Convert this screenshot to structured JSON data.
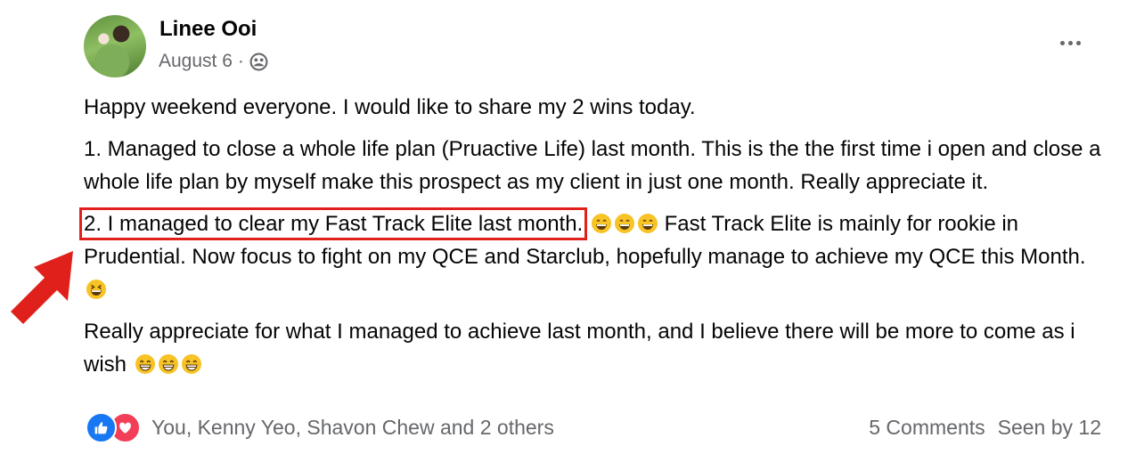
{
  "post": {
    "author": "Linee Ooi",
    "date": "August 6",
    "separator": "·",
    "privacy_icon": "group-icon",
    "paragraphs": [
      "Happy weekend everyone. I would like to share my 2 wins today.",
      "1. Managed to close a whole life plan (Pruactive Life) last month. This is the the first time i open and close a whole life plan by myself make this prospect as my client in just one month. Really appreciate it.",
      "Really appreciate for what I managed to achieve last month, and I believe there will be more to come as i wish"
    ],
    "highlighted": "2. I managed to clear my Fast Track Elite last month.",
    "p3_after": " Fast Track Elite is mainly for rookie in Prudential. Now focus to fight on my QCE and Starclub, hopefully manage to achieve my QCE this Month.",
    "highlight_color": "#e0211b"
  },
  "footer": {
    "reactions": [
      "like-icon",
      "love-icon"
    ],
    "reactors": "You, Kenny Yeo, Shavon Chew and 2 others",
    "comments": "5 Comments",
    "seen": "Seen by 12"
  }
}
